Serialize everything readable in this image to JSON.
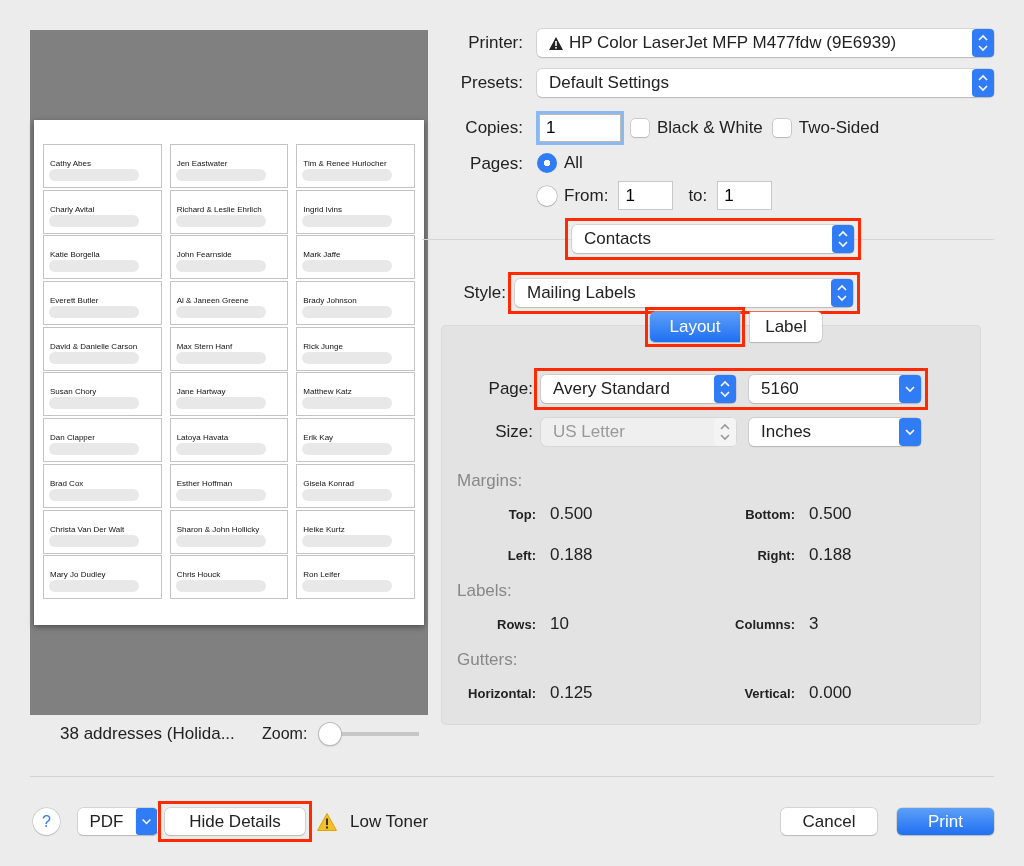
{
  "preview": {
    "labels": [
      {
        "name": "Cathy Abes"
      },
      {
        "name": "Jen Eastwater"
      },
      {
        "name": "Tim & Renee Hurlocher"
      },
      {
        "name": "Charly Avital"
      },
      {
        "name": "Richard & Leslie Ehrlich"
      },
      {
        "name": "Ingrid Ivins"
      },
      {
        "name": "Katie Borgella"
      },
      {
        "name": "John Fearnside"
      },
      {
        "name": "Mark Jaffe"
      },
      {
        "name": "Everett Butler"
      },
      {
        "name": "Al & Janeen Greene"
      },
      {
        "name": "Brady Johnson"
      },
      {
        "name": "David & Danielle Carson"
      },
      {
        "name": "Max Stern Hanf"
      },
      {
        "name": "Rick Junge"
      },
      {
        "name": "Susan Chory"
      },
      {
        "name": "Jane Hartway"
      },
      {
        "name": "Matthew Katz"
      },
      {
        "name": "Dan Clapper"
      },
      {
        "name": "Latoya Havata"
      },
      {
        "name": "Erik Kay"
      },
      {
        "name": "Brad Cox"
      },
      {
        "name": "Esther Hoffman"
      },
      {
        "name": "Gisela Konrad"
      },
      {
        "name": "Christa Van Der Walt"
      },
      {
        "name": "Sharon & John Hollicky"
      },
      {
        "name": "Heike Kurtz"
      },
      {
        "name": "Mary Jo Dudley"
      },
      {
        "name": "Chris Houck"
      },
      {
        "name": "Ron Leifer"
      }
    ],
    "summary": "38 addresses (Holida...",
    "zoom": {
      "label": "Zoom:",
      "level": 0
    }
  },
  "printer": {
    "label": "Printer:",
    "value": "HP Color LaserJet MFP M477fdw (9E6939)",
    "warning": true
  },
  "presets": {
    "label": "Presets:",
    "value": "Default Settings"
  },
  "copies": {
    "label": "Copies:",
    "value": "1"
  },
  "options": [
    {
      "label": "Black & White",
      "checked": false
    },
    {
      "label": "Two-Sided",
      "checked": false
    }
  ],
  "pages": {
    "label": "Pages:",
    "choices": [
      {
        "label": "All",
        "selected": true
      },
      {
        "label": "From:",
        "selected": false
      }
    ],
    "from": "1",
    "to_label": "to:",
    "to": "1"
  },
  "app_menu": {
    "value": "Contacts",
    "highlighted": true
  },
  "style": {
    "label": "Style:",
    "value": "Mailing Labels",
    "highlighted": true
  },
  "tabs": [
    {
      "label": "Layout",
      "selected": true,
      "highlighted": true
    },
    {
      "label": "Label",
      "selected": false
    }
  ],
  "layout": {
    "page": {
      "label": "Page:",
      "value": "Avery Standard",
      "number": "5160",
      "highlighted": true
    },
    "size": {
      "label": "Size:",
      "value": "US Letter",
      "disabled": true,
      "units": "Inches"
    },
    "sections": [
      {
        "title": "Margins:",
        "fields": [
          {
            "label": "Top:",
            "value": "0.500"
          },
          {
            "label": "Bottom:",
            "value": "0.500"
          },
          {
            "label": "Left:",
            "value": "0.188"
          },
          {
            "label": "Right:",
            "value": "0.188"
          }
        ]
      },
      {
        "title": "Labels:",
        "fields": [
          {
            "label": "Rows:",
            "value": "10"
          },
          {
            "label": "Columns:",
            "value": "3"
          }
        ]
      },
      {
        "title": "Gutters:",
        "fields": [
          {
            "label": "Horizontal:",
            "value": "0.125"
          },
          {
            "label": "Vertical:",
            "value": "0.000"
          }
        ]
      }
    ]
  },
  "footer": {
    "help": "?",
    "pdf": "PDF",
    "details": {
      "label": "Hide Details",
      "highlighted": true
    },
    "warning": "Low Toner",
    "buttons": [
      {
        "label": "Cancel",
        "kind": "secondary"
      },
      {
        "label": "Print",
        "kind": "default"
      }
    ]
  }
}
